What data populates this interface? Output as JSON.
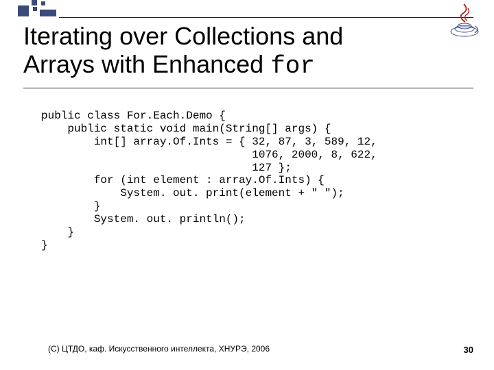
{
  "title": {
    "line1": "Iterating over Collections and",
    "line2_prefix": "Arrays with Enhanced ",
    "line2_keyword": "for"
  },
  "code_lines": [
    "public class For.Each.Demo {",
    "    public static void main(String[] args) {",
    "        int[] array.Of.Ints = { 32, 87, 3, 589, 12,",
    "                                1076, 2000, 8, 622,",
    "                                127 };",
    "        for (int element : array.Of.Ints) {",
    "            System. out. print(element + \" \");",
    "        }",
    "        System. out. println();",
    "    }",
    "}"
  ],
  "footer": "(C) ЦТДО, каф. Искусственного интеллекта, ХНУРЭ, 2006",
  "page_number": "30"
}
